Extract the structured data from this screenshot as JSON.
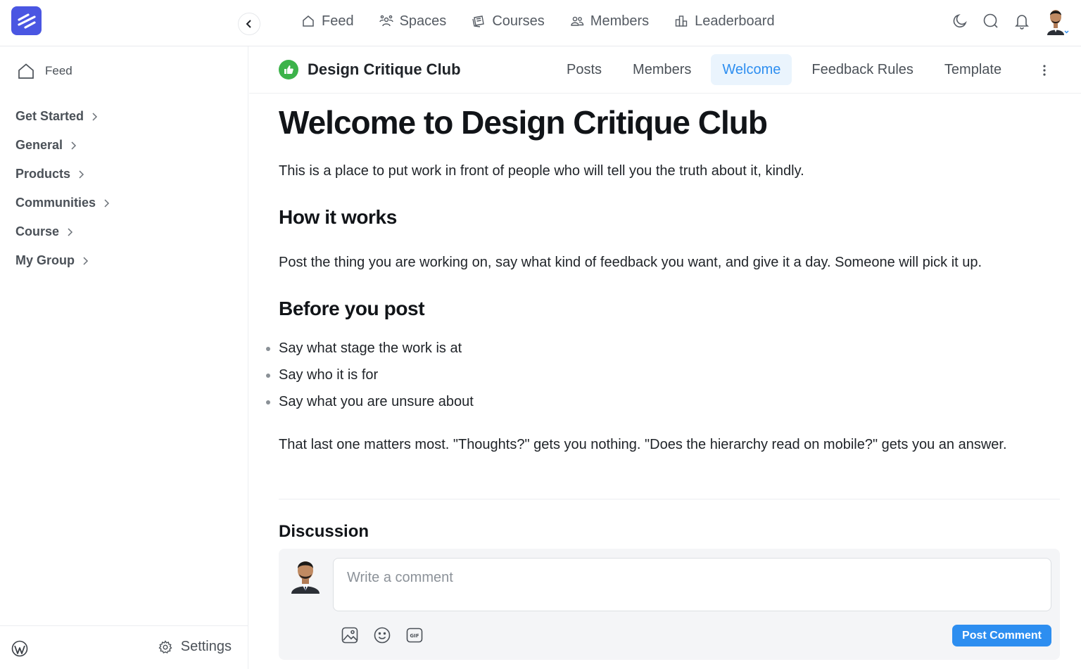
{
  "topnav": {
    "items": [
      {
        "label": "Feed",
        "icon": "home-icon"
      },
      {
        "label": "Spaces",
        "icon": "spaces-icon"
      },
      {
        "label": "Courses",
        "icon": "courses-icon"
      },
      {
        "label": "Members",
        "icon": "members-icon"
      },
      {
        "label": "Leaderboard",
        "icon": "leaderboard-icon"
      }
    ],
    "actions": [
      "moon-icon",
      "search-icon",
      "bell-icon",
      "avatar"
    ]
  },
  "sidebar": {
    "feed_label": "Feed",
    "groups": [
      "Get Started",
      "General",
      "Products",
      "Communities",
      "Course",
      "My Group"
    ],
    "settings_label": "Settings"
  },
  "space": {
    "title": "Design Critique Club",
    "tabs": [
      "Posts",
      "Members",
      "Welcome",
      "Feedback Rules",
      "Template"
    ],
    "active_tab": "Welcome"
  },
  "article": {
    "title": "Welcome to Design Critique Club",
    "intro": "This is a place to put work in front of people who will tell you the truth about it, kindly.",
    "section1_heading": "How it works",
    "section1_body": "Post the thing you are working on, say what kind of feedback you want, and give it a day. Someone will pick it up.",
    "section2_heading": "Before you post",
    "bullets": [
      "Say what stage the work is at",
      "Say who it is for",
      "Say what you are unsure about"
    ],
    "closing": "That last one matters most. \"Thoughts?\" gets you nothing. \"Does the hierarchy read on mobile?\" gets you an answer."
  },
  "discussion": {
    "title": "Discussion",
    "placeholder": "Write a comment",
    "post_button": "Post Comment",
    "tools": [
      "image-icon",
      "emoji-icon",
      "gif-icon"
    ]
  },
  "colors": {
    "brand": "#4a56e2",
    "accent": "#2d8ef0",
    "space_icon": "#3cb34a"
  }
}
